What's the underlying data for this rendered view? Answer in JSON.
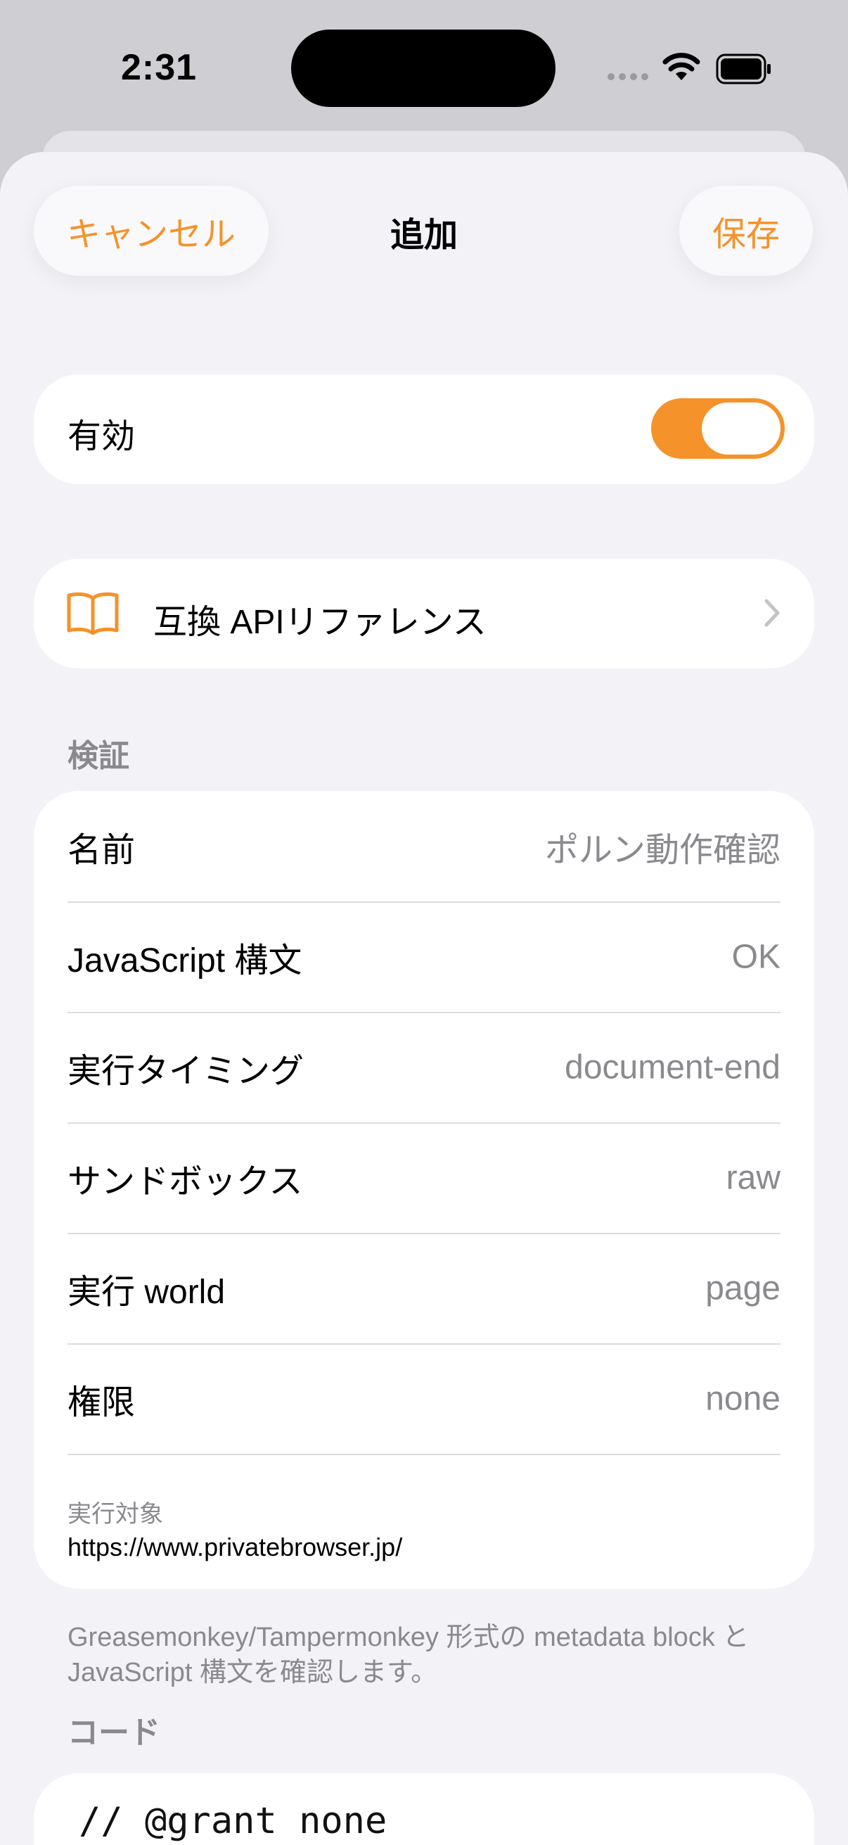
{
  "status_bar": {
    "time": "2:31"
  },
  "nav": {
    "cancel_label": "キャンセル",
    "title": "追加",
    "save_label": "保存"
  },
  "enabled": {
    "label": "有効",
    "value": true
  },
  "api_reference": {
    "label": "互換 APIリファレンス",
    "icon": "book-icon"
  },
  "validation": {
    "header": "検証",
    "rows": [
      {
        "key": "名前",
        "value": "ポルン動作確認"
      },
      {
        "key": "JavaScript 構文",
        "value": "OK"
      },
      {
        "key": "実行タイミング",
        "value": "document-end"
      },
      {
        "key": "サンドボックス",
        "value": "raw"
      },
      {
        "key": "実行 world",
        "value": "page"
      },
      {
        "key": "権限",
        "value": "none"
      }
    ],
    "target_label": "実行対象",
    "target_value": "https://www.privatebrowser.jp/",
    "footnote": "Greasemonkey/Tampermonkey 形式の metadata block と JavaScript 構文を確認します。"
  },
  "code": {
    "header": "コード",
    "first_line": "// @grant none"
  },
  "colors": {
    "accent": "#F5922A",
    "background": "#F2F2F7",
    "secondary_text": "#8A8A8E"
  }
}
